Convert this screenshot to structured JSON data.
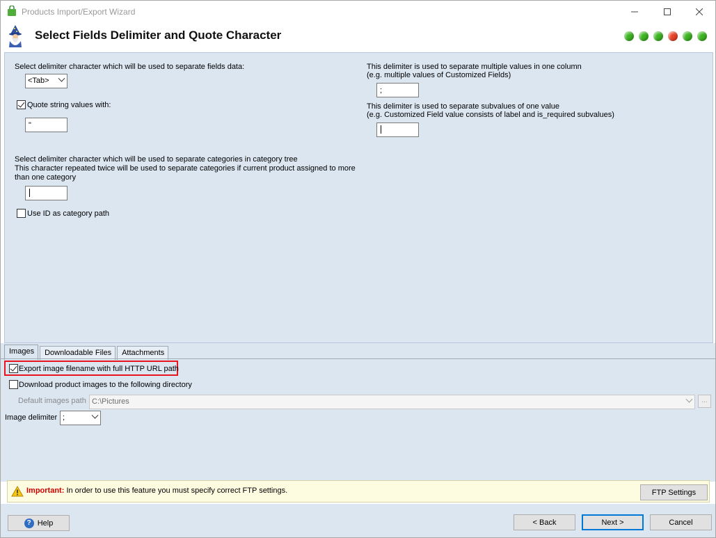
{
  "window": {
    "title": "Products Import/Export Wizard"
  },
  "header": {
    "title": "Select Fields Delimiter and Quote Character",
    "step_dots": [
      "#3cb521",
      "#3cb521",
      "#3cb521",
      "#e8432a",
      "#3cb521",
      "#3cb521"
    ]
  },
  "left": {
    "field_delim_label": "Select delimiter character which will be used to separate fields data:",
    "field_delim_value": "<Tab>",
    "quote_label": "Quote string values with:",
    "quote_checked": true,
    "quote_value": "\"",
    "category_label_line1": "Select delimiter character which will be used to separate categories in category tree",
    "category_label_line2": "This character repeated twice will be used to separate categories if current product assigned to more",
    "category_label_line3": "than one category",
    "category_value": "",
    "use_id_label": "Use ID as category path",
    "use_id_checked": false
  },
  "right": {
    "multi_label_line1": "This delimiter is used to separate multiple values in one column",
    "multi_label_line2": "(e.g. multiple values of Customized Fields)",
    "multi_value": ";",
    "sub_label_line1": "This delimiter is used to separate subvalues of one value",
    "sub_label_line2": "(e.g. Customized Field value consists of label and is_required subvalues)",
    "sub_value": ""
  },
  "tabs": [
    "Images",
    "Downloadable Files",
    "Attachments"
  ],
  "images": {
    "export_full_url_label": "Export image filename with full HTTP URL path",
    "export_full_url_checked": true,
    "download_label": "Download product images to the following directory",
    "download_checked": false,
    "default_path_label": "Default images path",
    "default_path_value": "C:\\Pictures",
    "browse_label": "...",
    "image_delim_label": "Image delimiter",
    "image_delim_value": ";"
  },
  "banner": {
    "important_label": "Important:",
    "message": " In order to use this feature you must specify correct FTP settings.",
    "ftp_button": "FTP Settings"
  },
  "footer": {
    "help_label": "Help",
    "back_label": "< Back",
    "next_label": "Next >",
    "cancel_label": "Cancel"
  }
}
